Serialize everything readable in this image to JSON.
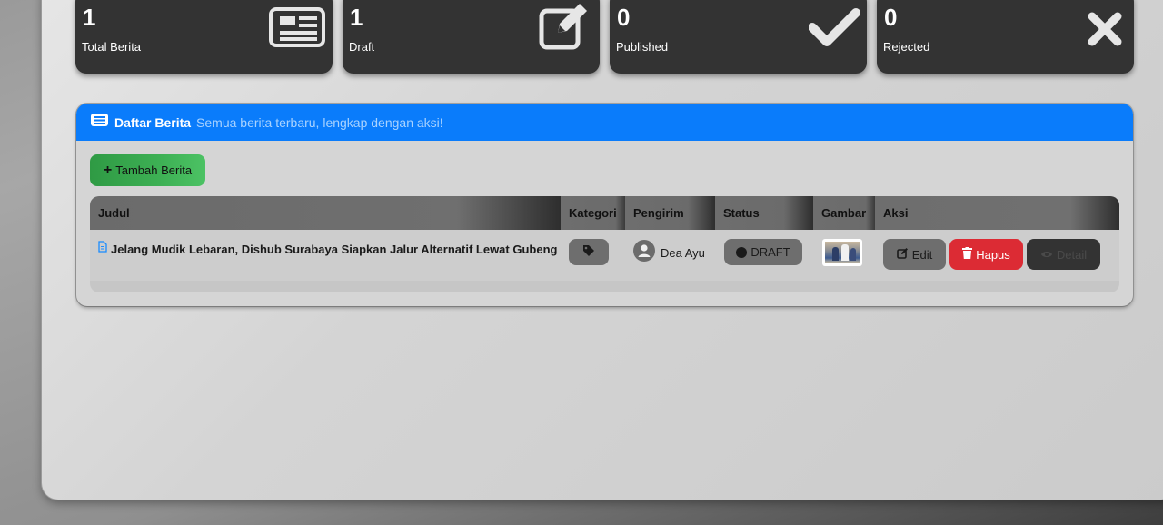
{
  "stats": [
    {
      "value": "1",
      "label": "Total Berita",
      "icon": "newspaper-icon"
    },
    {
      "value": "1",
      "label": "Draft",
      "icon": "edit-icon"
    },
    {
      "value": "0",
      "label": "Published",
      "icon": "check-icon"
    },
    {
      "value": "0",
      "label": "Rejected",
      "icon": "x-icon"
    }
  ],
  "news_card": {
    "title": "Daftar Berita",
    "subtitle": "Semua berita terbaru, lengkap dengan aksi!",
    "add_button": "Tambah Berita",
    "accent": "#0a7cfb"
  },
  "table": {
    "columns": [
      "Judul",
      "Kategori",
      "Pengirim",
      "Status",
      "Gambar",
      "Aksi"
    ],
    "rows": [
      {
        "title": "Jelang Mudik Lebaran, Dishub Surabaya Siapkan Jalur Alternatif Lewat Gubeng",
        "sender": "Dea Ayu",
        "status": "DRAFT",
        "actions": {
          "edit": "Edit",
          "delete": "Hapus",
          "detail": "Detail"
        }
      }
    ]
  },
  "colors": {
    "delete": "#dc2b34",
    "add": "#3aa84f",
    "stat_bg": "#333333"
  }
}
